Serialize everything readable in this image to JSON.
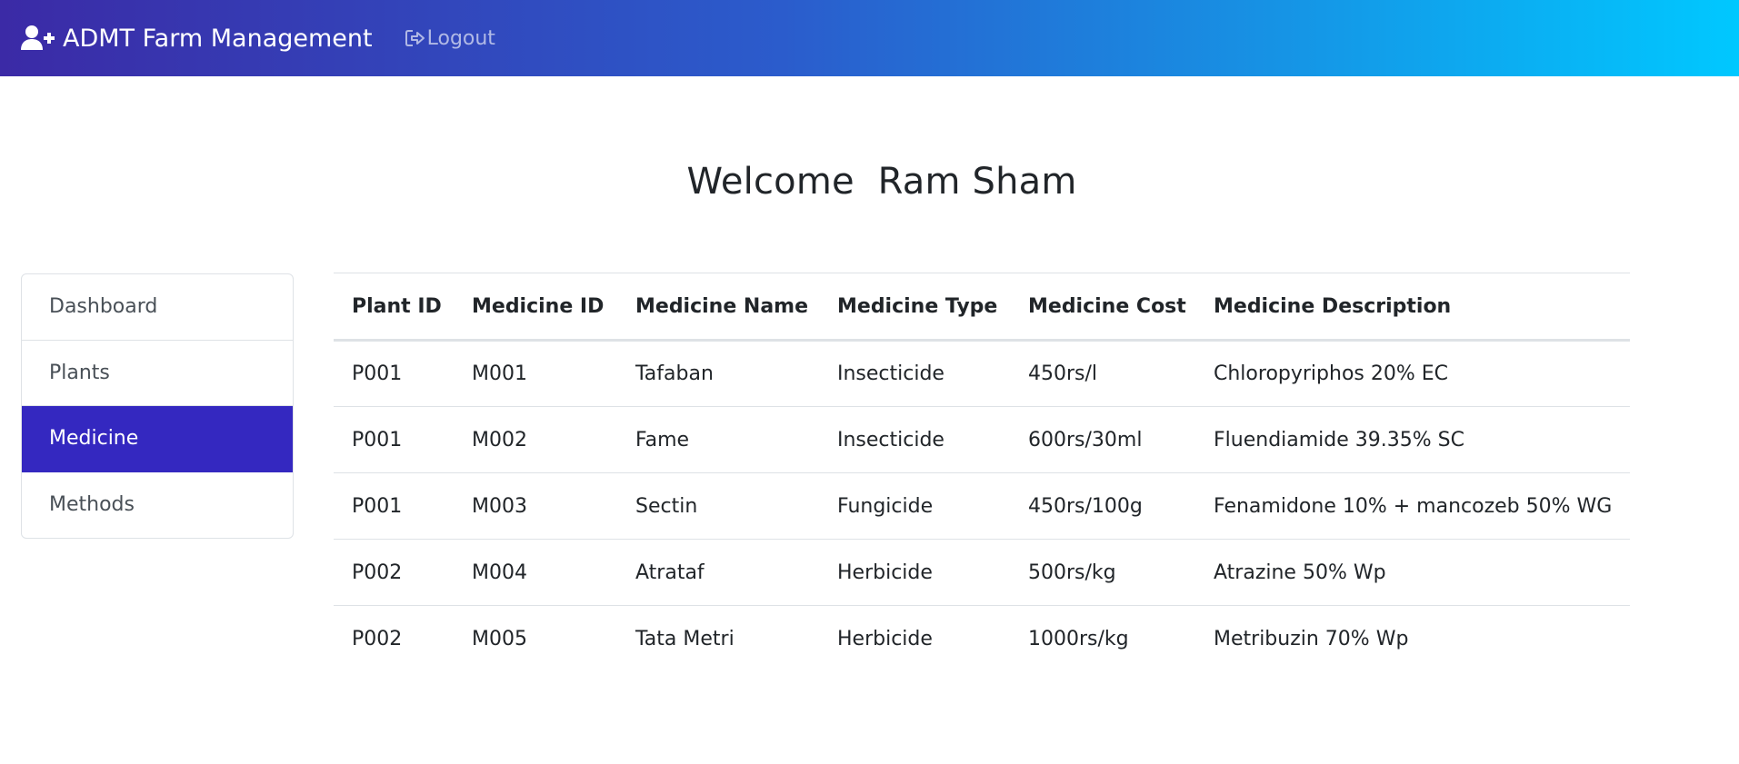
{
  "navbar": {
    "brand_label": "ADMT Farm Management",
    "brand_icon": "user-plus-icon",
    "logout_label": "Logout",
    "logout_icon": "sign-out-icon"
  },
  "welcome": {
    "text": "Welcome  Ram Sham"
  },
  "sidebar": {
    "items": [
      {
        "label": "Dashboard",
        "active": false
      },
      {
        "label": "Plants",
        "active": false
      },
      {
        "label": "Medicine",
        "active": true
      },
      {
        "label": "Methods",
        "active": false
      }
    ],
    "active_color": "#3428c0"
  },
  "table": {
    "headers": [
      "Plant ID",
      "Medicine ID",
      "Medicine Name",
      "Medicine Type",
      "Medicine Cost",
      "Medicine Description"
    ],
    "rows": [
      [
        "P001",
        "M001",
        "Tafaban",
        "Insecticide",
        "450rs/l",
        "Chloropyriphos 20% EC"
      ],
      [
        "P001",
        "M002",
        "Fame",
        "Insecticide",
        "600rs/30ml",
        "Fluendiamide 39.35% SC"
      ],
      [
        "P001",
        "M003",
        "Sectin",
        "Fungicide",
        "450rs/100g",
        "Fenamidone 10% + mancozeb 50% WG"
      ],
      [
        "P002",
        "M004",
        "Atrataf",
        "Herbicide",
        "500rs/kg",
        "Atrazine 50% Wp"
      ],
      [
        "P002",
        "M005",
        "Tata Metri",
        "Herbicide",
        "1000rs/kg",
        "Metribuzin 70% Wp"
      ]
    ]
  },
  "colors": {
    "navbar_gradient_start": "#3b2aa6",
    "navbar_gradient_end": "#00c8ff"
  }
}
